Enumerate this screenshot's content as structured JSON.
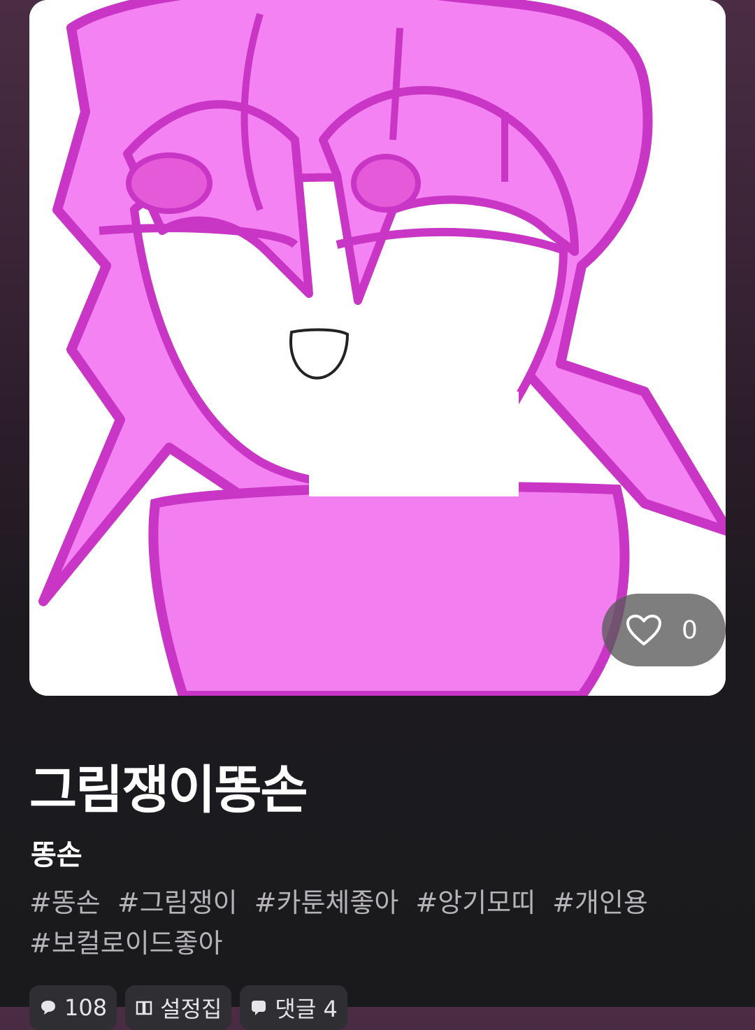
{
  "hero": {
    "like_count": "0",
    "heart_icon": "heart-outline-icon"
  },
  "title": "그림쟁이똥손",
  "author": "똥손",
  "tags": [
    "#똥손",
    "#그림쟁이",
    "#카툰체좋아",
    "#앙기모띠",
    "#개인용",
    "#보컬로이드좋아"
  ],
  "chips": [
    {
      "icon": "chat-bubble-icon",
      "label": "108"
    },
    {
      "icon": "book-icon",
      "label": "설정집"
    },
    {
      "icon": "comment-icon",
      "label": "댓글 4"
    }
  ],
  "colors": {
    "hair": "#f27ef0",
    "outline": "#c935c4",
    "background_top": "#4a2d44",
    "background_bottom": "#1a1a1c"
  }
}
